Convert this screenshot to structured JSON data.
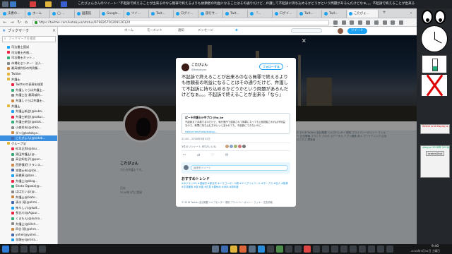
{
  "window": {
    "title": "こたびょんさんのツイート: \"不起訴で終えることが出来るのなら無罪で終えるよりも依頼者の利益になることはその通りだけど、弁護して不起訴に持ち込めるかどうかという問題があるんだけどなぁ。。。不起訴で終えることが出来る「なら」。 — Mozilla Firefox"
  },
  "colors": {
    "twitter_blue": "#1da1f2",
    "selection_blue": "#3b8fe0",
    "os_bar": "#1e2226",
    "taskbar": "#151719"
  },
  "tabs": [
    {
      "label": "法曹の..."
    },
    {
      "label": "ホーム"
    },
    {
      "label": "◯ ..."
    },
    {
      "label": "図書館"
    },
    {
      "label": "Google..."
    },
    {
      "label": "ツイ..."
    },
    {
      "label": "Twit..."
    },
    {
      "label": "ログイ..."
    },
    {
      "label": "旅行サ..."
    },
    {
      "label": "Twit..."
    },
    {
      "label": "「..."
    },
    {
      "label": "ログイ..."
    },
    {
      "label": "Twit..."
    },
    {
      "label": "Twit..."
    },
    {
      "label": "こたびょ..."
    }
  ],
  "navbar": {
    "url": "https://twitter.com/kotabyon/status/979826750209126120"
  },
  "sidebar": {
    "title": "ブックマーク",
    "close": "×",
    "search_placeholder": "ブックマークを検索",
    "items": [
      {
        "label": "司法書士国試",
        "type": "bm",
        "indent": 1
      },
      {
        "label": "司法書士合格...",
        "type": "bm",
        "indent": 1
      },
      {
        "label": "司法書士ネット...",
        "type": "bm",
        "indent": 1
      },
      {
        "label": "市場化センター：法人...",
        "type": "bm",
        "indent": 1
      },
      {
        "label": "最高裁判所の判例集...",
        "type": "bm",
        "indent": 1
      },
      {
        "label": "Twitter",
        "type": "folder",
        "indent": 1
      },
      {
        "label": "弁護士",
        "type": "folder",
        "indent": 1
      },
      {
        "label": "Twitterの表現を検索",
        "type": "bm",
        "indent": 2
      },
      {
        "label": "弁護しぐらば弁護士...",
        "type": "bm",
        "indent": 2
      },
      {
        "label": "弁護士会 最高裁判...",
        "type": "bm",
        "indent": 2
      },
      {
        "label": "弁護しぐらば弁護士...",
        "type": "bm",
        "indent": 2
      },
      {
        "label": "弁護士",
        "type": "folder",
        "indent": 1
      },
      {
        "label": "弁護士新会(@kubo...",
        "type": "bm",
        "indent": 2
      },
      {
        "label": "弁護士新会(@sakur...",
        "type": "bm",
        "indent": 2
      },
      {
        "label": "弁護士新会(@otok...",
        "type": "bm",
        "indent": 2
      },
      {
        "label": "小森秀夫(@ohka...",
        "type": "bm",
        "indent": 2
      },
      {
        "label": "ダン(@kotabyo...",
        "type": "bm",
        "indent": 2
      },
      {
        "label": "こたびょん(@kotab...",
        "type": "bm",
        "indent": 2,
        "selected": true
      },
      {
        "label": "グループ法",
        "type": "folder",
        "indent": 1
      },
      {
        "label": "松本正和(@kou...",
        "type": "bm",
        "indent": 2
      },
      {
        "label": "黒田弁護士(@...",
        "type": "bm",
        "indent": 2
      },
      {
        "label": "高谷知佐子(@pan...",
        "type": "bm",
        "indent": 2
      },
      {
        "label": "西野慎紀(フランス...",
        "type": "bm",
        "indent": 2
      },
      {
        "label": "本職士夫(@tok...",
        "type": "bm",
        "indent": 2
      },
      {
        "label": "高橋恵(@ban...",
        "type": "bm",
        "indent": 2
      },
      {
        "label": "弁護士(@blog...",
        "type": "bm",
        "indent": 2
      },
      {
        "label": "Shota Ogawa(@...",
        "type": "bm",
        "indent": 2
      },
      {
        "label": "ぱぱだいま(@...",
        "type": "bm",
        "indent": 2
      },
      {
        "label": "弁護士@(kato...",
        "type": "bm",
        "indent": 2
      },
      {
        "label": "清水 晃(@ohmi...",
        "type": "bm",
        "indent": 2
      },
      {
        "label": "神々しい(@twit...",
        "type": "bm",
        "indent": 2
      },
      {
        "label": "長谷川(@Agour...",
        "type": "bm",
        "indent": 2
      },
      {
        "label": "くまもん(@kuma...",
        "type": "bm",
        "indent": 2
      },
      {
        "label": "弁護士(@kitch...",
        "type": "bm",
        "indent": 2
      },
      {
        "label": "四谷 稔(@ohm...",
        "type": "bm",
        "indent": 2
      },
      {
        "label": "yohei(@yohei...",
        "type": "bm",
        "indent": 2
      },
      {
        "label": "金融士(@mira...",
        "type": "bm",
        "indent": 2
      },
      {
        "label": "弁護士ベンチャ...",
        "type": "bm",
        "indent": 2
      },
      {
        "label": "田辺(@tanaa...",
        "type": "bm",
        "indent": 2
      }
    ]
  },
  "twitter_nav": {
    "home": "ホーム",
    "moments": "モーメント",
    "notifications": "通知",
    "messages": "メッセージ",
    "search_placeholder": "キーワード検索",
    "tweet_button": "ツイート"
  },
  "profile": {
    "name": "こたびょん",
    "bio": "ただの弁護士です。",
    "location": "日本",
    "joined": "2016年2月に登録"
  },
  "footer_links": "© 2018 Twitter 会社概要 ヘルプセンター 規約 プライバシーポリシー クッキー 広告情報 ブランド ブログ ステータス アプリ連携 求人 マーケティング 広告 ビジネス 開発者",
  "modal": {
    "author_name": "こたびょん",
    "author_handle": "@kotabyon",
    "follow_label": "フォローする",
    "tweet_text": "不起訴で終えることが出来るのなら無罪で終えるよりも依頼者の利益になることはその通りだけど、弁護して不起訴に持ち込めるかどうかという問題があるんだけどなぁ。。。不起訴で終えることが出来る「なら」",
    "quote": {
      "header": "ぱーそ弁護士@中ブロ @ta_ke",
      "body": "不起訴まで弁護するのだけど、執行猶予で起訴されて無罪になっても公訴提起されれば不利益なので、無罪に持ち込む方がいいと言われても、不起訴にできないのに...",
      "link": "twitter.com/i/web/status/..."
    },
    "timestamp": "22:00 - 2018年3月31日",
    "stats": "3件のリツイート 6件のいいね",
    "reply_placeholder": "返信をツイート",
    "trends_title": "おすすめトレンド",
    "trends": "#ポケモンGO #漫画村 #新元号 #ドラゴンボール超 #エイプリルフール #ホークス #巨人 #阪神 #平成最後 #桜 #嵐 #花見 #春休み #AKB #新年度",
    "footer": "© 2018 Twitter 会社概要 ヘルプセンター 規約 プライバシーポリシー クッキー 広告情報"
  },
  "desktop_widgets": {
    "mini1_title": "Select and display a...",
    "mini2_title": "xkeyvp 2018年 2018/4",
    "mini2_button": "screenShot"
  },
  "taskbar": {
    "time": "9:40",
    "date": "2018年3月31日 土曜日"
  }
}
